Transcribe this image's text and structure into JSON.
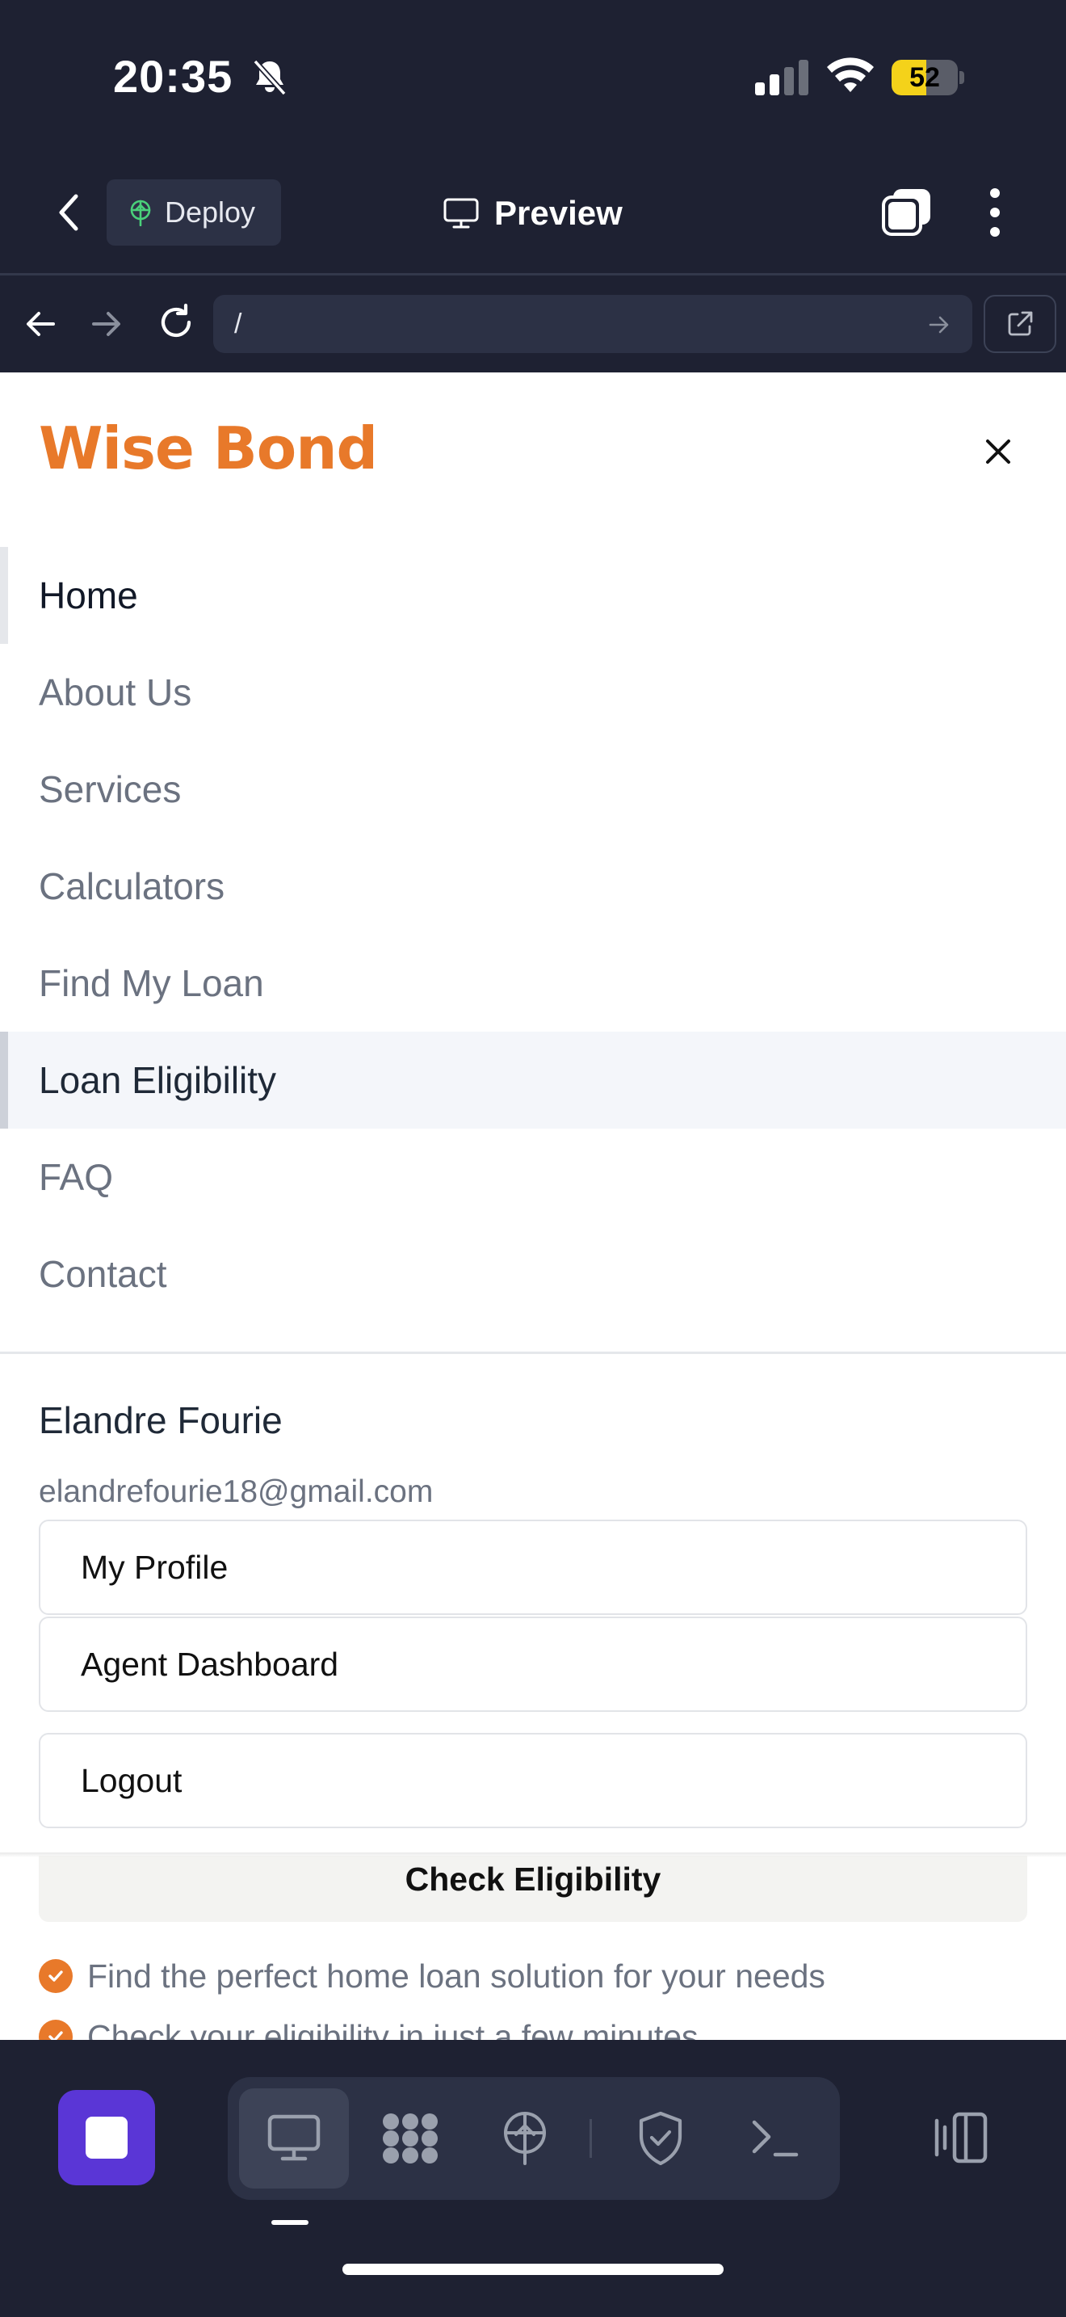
{
  "status_bar": {
    "time": "20:35",
    "battery_level": "52",
    "battery_fraction": 0.52,
    "icons": [
      "bell-slash-icon",
      "cellular-signal-icon",
      "wifi-icon",
      "battery-icon"
    ]
  },
  "app_bar": {
    "deploy_label": "Deploy",
    "preview_label": "Preview",
    "icons": [
      "chevron-left-icon",
      "deploy-icon",
      "monitor-icon",
      "tabs-icon",
      "more-vertical-icon"
    ]
  },
  "browser_bar": {
    "url_value": "/",
    "icons": [
      "arrow-left-icon",
      "arrow-right-icon",
      "reload-icon",
      "arrow-go-icon",
      "external-link-icon"
    ]
  },
  "site": {
    "brand": "Wise Bond",
    "brand_color": "#e8792a",
    "menu": [
      {
        "label": "Home"
      },
      {
        "label": "About Us"
      },
      {
        "label": "Services"
      },
      {
        "label": "Calculators"
      },
      {
        "label": "Find My Loan"
      },
      {
        "label": "Loan Eligibility"
      },
      {
        "label": "FAQ"
      },
      {
        "label": "Contact"
      }
    ],
    "active_item": "Home",
    "hovered_item": "Loan Eligibility",
    "user": {
      "name": "Elandre Fourie",
      "email": "elandrefourie18@gmail.com"
    },
    "account_actions": {
      "profile": "My Profile",
      "dashboard": "Agent Dashboard",
      "logout": "Logout"
    },
    "check_eligibility_label": "Check Eligibility",
    "features": [
      "Find the perfect home loan solution for your needs",
      "Check your eligibility in just a few minutes"
    ]
  },
  "toolbar": {
    "accent_color": "#5a36d6",
    "icons": [
      "stop-icon",
      "monitor-icon",
      "modules-icon",
      "deploy-icon",
      "shield-check-icon",
      "terminal-icon",
      "panel-toggle-icon"
    ]
  }
}
